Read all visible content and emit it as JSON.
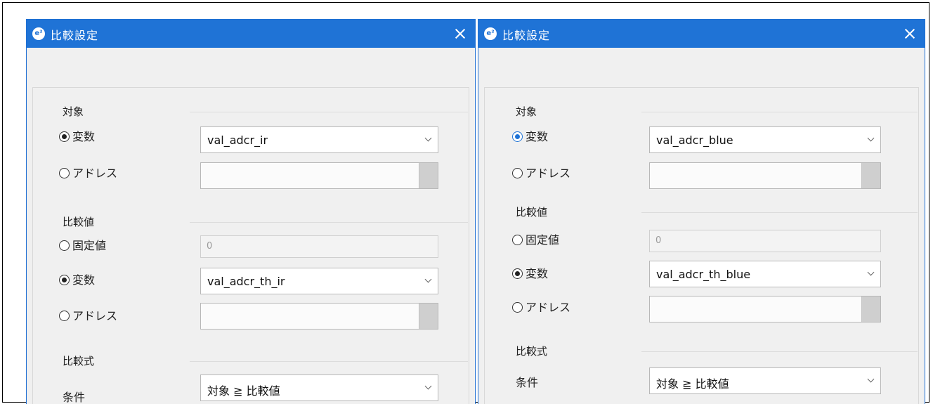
{
  "dialogs": [
    {
      "title": "比較設定",
      "target": {
        "label": "対象",
        "radio_variable": "変数",
        "radio_address": "アドレス",
        "variable_value": "val_adcr_ir",
        "address_value": ""
      },
      "compare": {
        "label": "比較値",
        "radio_fixed": "固定値",
        "fixed_value": "0",
        "radio_variable": "変数",
        "variable_value": "val_adcr_th_ir",
        "radio_address": "アドレス",
        "address_value": ""
      },
      "expression": {
        "label": "比較式",
        "condition_label": "条件",
        "condition_value": "対象 ≧ 比較値"
      }
    },
    {
      "title": "比較設定",
      "target": {
        "label": "対象",
        "radio_variable": "変数",
        "radio_address": "アドレス",
        "variable_value": "val_adcr_blue",
        "address_value": ""
      },
      "compare": {
        "label": "比較値",
        "radio_fixed": "固定値",
        "fixed_value": "0",
        "radio_variable": "変数",
        "variable_value": "val_adcr_th_blue",
        "radio_address": "アドレス",
        "address_value": ""
      },
      "expression": {
        "label": "比較式",
        "condition_label": "条件",
        "condition_value": "対象 ≧ 比較値"
      }
    }
  ],
  "colors": {
    "titlebar": "#1f73d6",
    "accent": "#1f73d6"
  }
}
